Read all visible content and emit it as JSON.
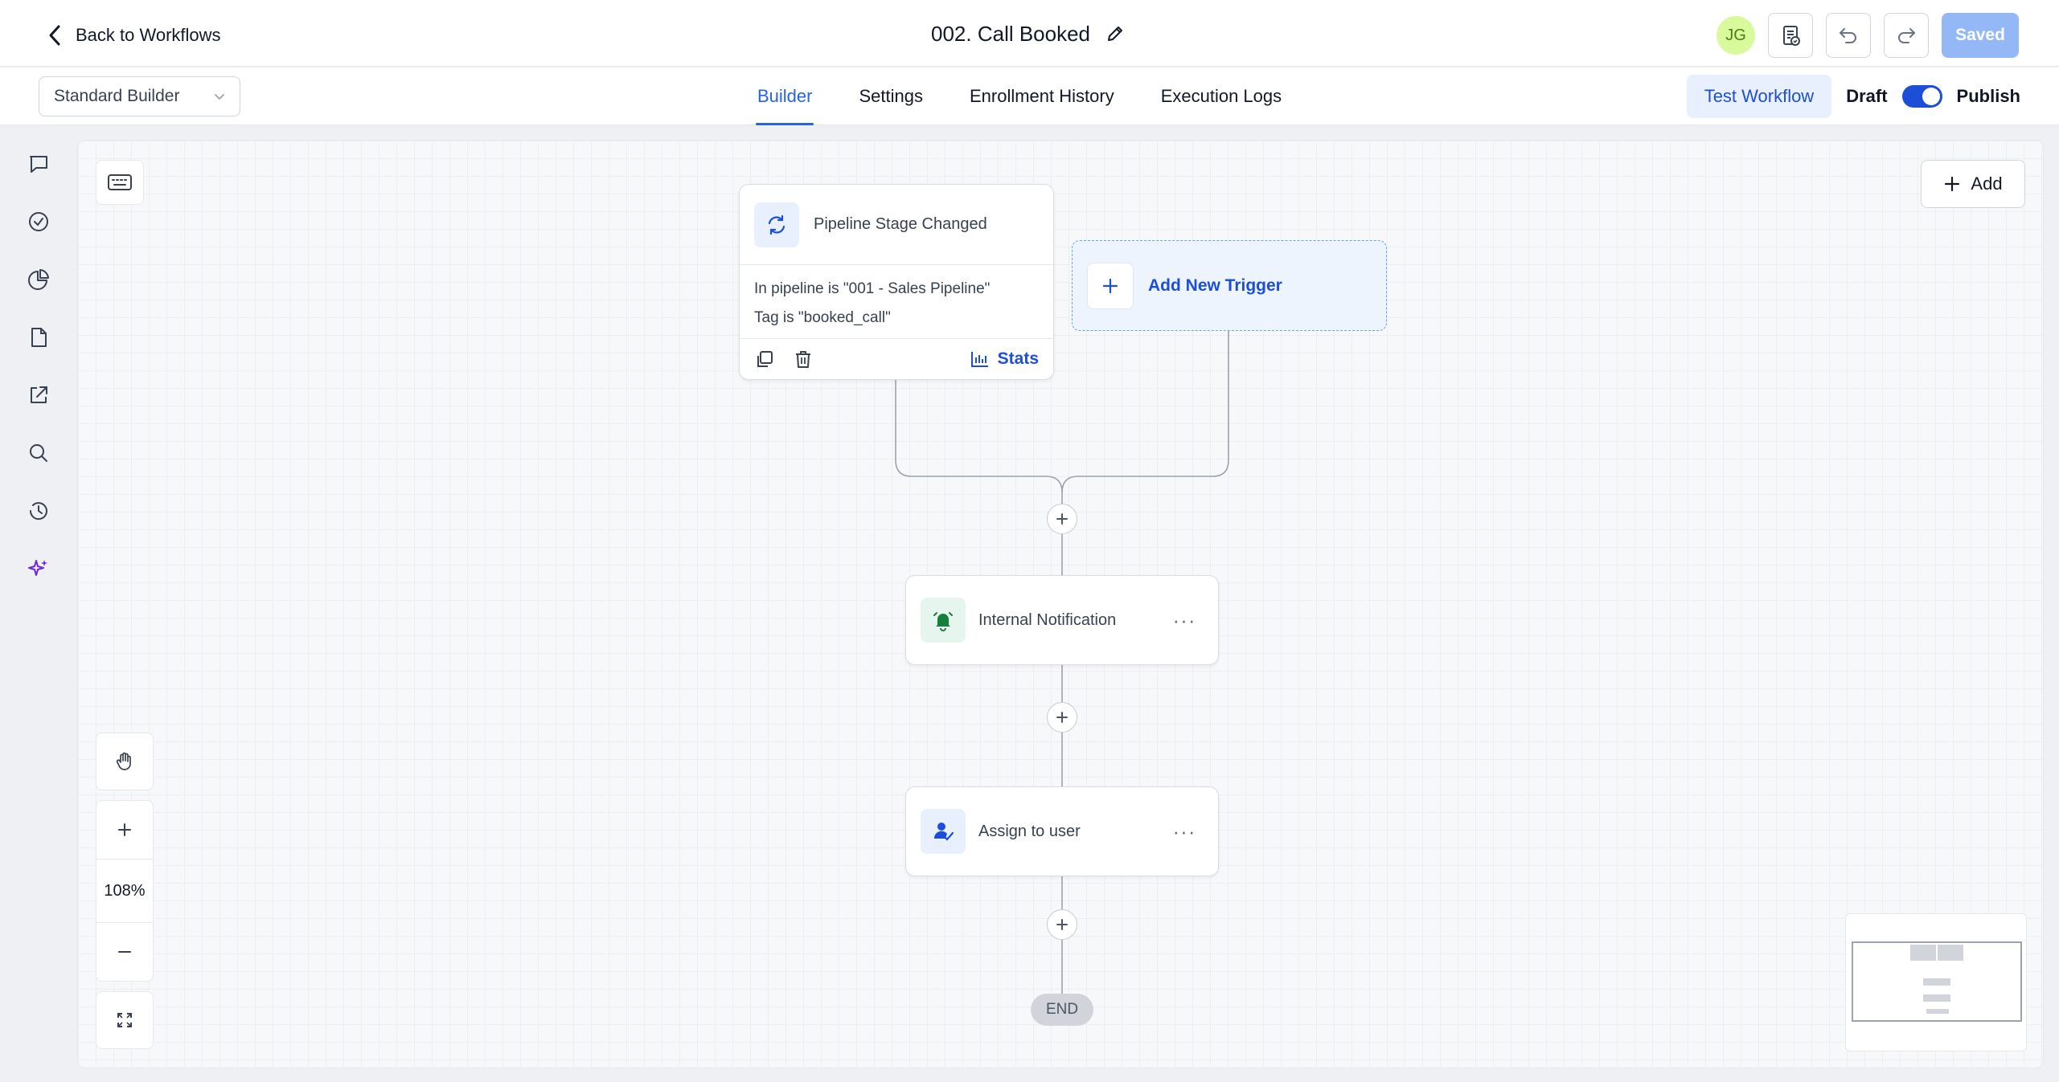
{
  "header": {
    "back_label": "Back to Workflows",
    "workflow_title": "002. Call Booked",
    "avatar_initials": "JG",
    "saved_label": "Saved"
  },
  "subbar": {
    "builder_mode": "Standard Builder",
    "tabs": [
      {
        "label": "Builder",
        "active": true
      },
      {
        "label": "Settings",
        "active": false
      },
      {
        "label": "Enrollment History",
        "active": false
      },
      {
        "label": "Execution Logs",
        "active": false
      }
    ],
    "test_workflow_label": "Test Workflow",
    "draft_label": "Draft",
    "publish_label": "Publish",
    "publish_toggle_on": true
  },
  "rail": {
    "icons": [
      "chat-icon",
      "check-circle-icon",
      "pie-chart-icon",
      "document-icon",
      "external-link-icon",
      "search-icon",
      "history-icon",
      "sparkles-icon"
    ]
  },
  "canvas": {
    "add_label": "Add",
    "trigger": {
      "title": "Pipeline Stage Changed",
      "conditions": [
        "In pipeline is \"001 - Sales Pipeline\"",
        "Tag is \"booked_call\""
      ],
      "stats_label": "Stats"
    },
    "new_trigger_label": "Add New Trigger",
    "actions": [
      {
        "label": "Internal Notification",
        "icon": "bell-icon"
      },
      {
        "label": "Assign to user",
        "icon": "user-assign-icon"
      }
    ],
    "end_label": "END",
    "zoom_level": "108%"
  },
  "colors": {
    "accent": "#2563eb",
    "notification_icon_bg": "#e6f6ef",
    "notification_icon": "#15803d",
    "assign_icon_bg": "#e8f0fe",
    "assign_icon": "#1d4ed8"
  }
}
